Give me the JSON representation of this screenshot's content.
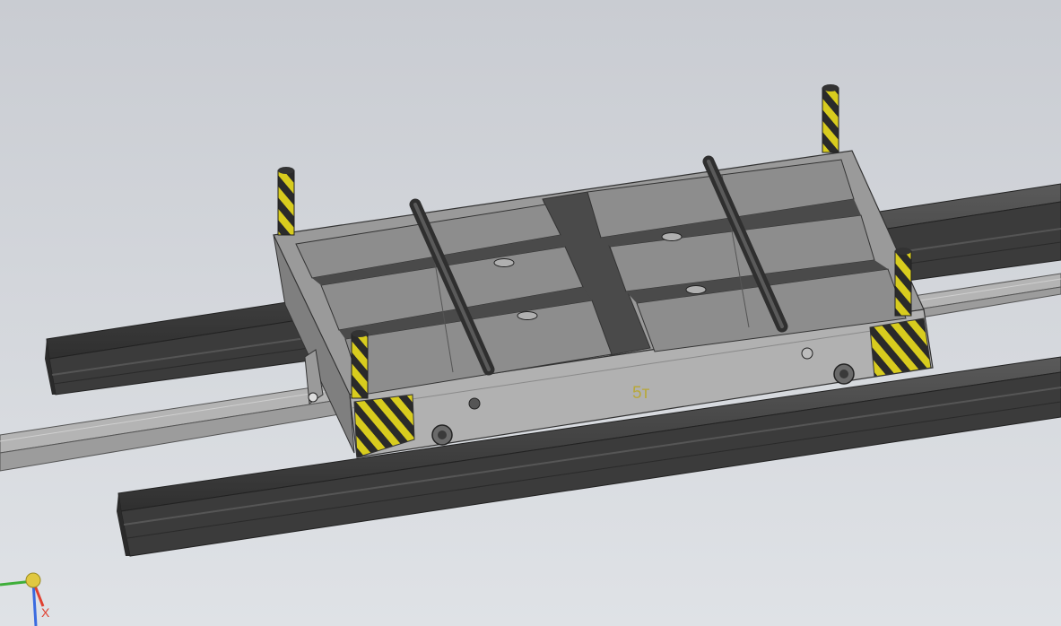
{
  "viewport": {
    "background_top": "#c9ccd2",
    "background_bottom": "#dfe2e6"
  },
  "model": {
    "capacity_label": "5т",
    "colors": {
      "rail": "#3e3e3e",
      "rail_highlight": "#5a5a5a",
      "track_steel": "#b4b4b4",
      "body_top": "#9a9a9a",
      "body_side": "#b1b1b1",
      "plate": "#8d8d8d",
      "plate_slot": "#4a4a4a",
      "warning_yellow": "#d8cc1e",
      "warning_black": "#2a2a2a",
      "label": "#b8a83a"
    }
  },
  "triad": {
    "x_label": "X",
    "x_color": "#e04030",
    "y_color": "#3fae3a",
    "z_color": "#3a6be0",
    "origin_color": "#e0c840"
  }
}
